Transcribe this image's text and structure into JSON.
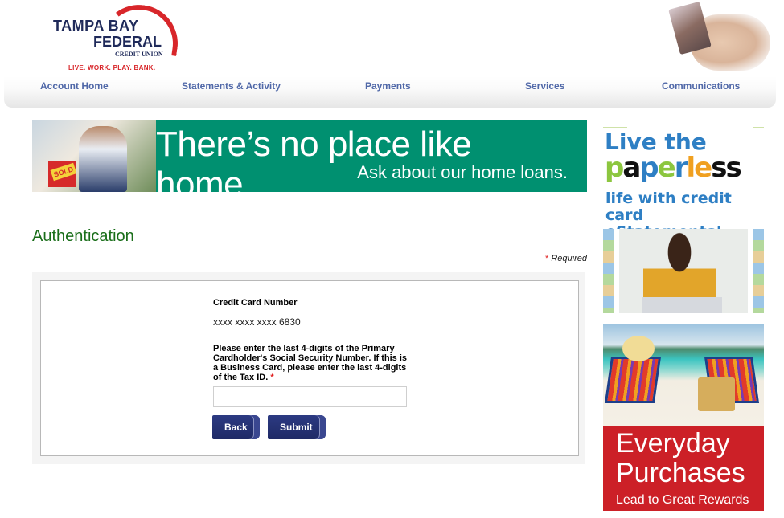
{
  "header": {
    "logo": {
      "line1": "TAMPA BAY",
      "line2": "FEDERAL",
      "line3": "CREDIT UNION",
      "tagline": "LIVE. WORK. PLAY. BANK."
    },
    "nav": [
      {
        "label": "Account Home"
      },
      {
        "label": "Statements & Activity"
      },
      {
        "label": "Payments"
      },
      {
        "label": "Services"
      },
      {
        "label": "Communications"
      }
    ]
  },
  "banner": {
    "sign_text": "SOLD",
    "headline": "There’s no place like home",
    "subline": "Ask about our home loans."
  },
  "main": {
    "title": "Authentication",
    "required_star": "*",
    "required_label": " Required",
    "form": {
      "cc_label": "Credit Card Number",
      "cc_value": "xxxx xxxx xxxx 6830",
      "ssn_label": "Please enter the last 4-digits of the Primary Cardholder's Social Security Number. If this is a Business Card, please enter the last 4-digits of the Tax ID. ",
      "ssn_required_star": "*",
      "ssn_value": "",
      "back_label": "Back",
      "submit_label": "Submit"
    }
  },
  "ads": {
    "paperless": {
      "line1": "Live the",
      "word": [
        "p",
        "a",
        "p",
        "e",
        "r",
        "l",
        "e",
        "s",
        "s"
      ],
      "word_colors": [
        "#8cc63f",
        "#111111",
        "#2e7fc4",
        "#8cc63f",
        "#2e7fc4",
        "#f0a020",
        "#f0a020",
        "#111111",
        "#111111"
      ],
      "line3": "life with credit",
      "line4": "card eStatements!"
    },
    "rewards": {
      "line1": "Everyday",
      "line2": "Purchases",
      "line3": "Lead to Great Rewards"
    }
  },
  "colors": {
    "nav_text": "#5068a8",
    "title_green": "#1a6e1a",
    "banner_green": "#009070",
    "button_blue": "#2c3a82",
    "rewards_red": "#cc2027"
  }
}
